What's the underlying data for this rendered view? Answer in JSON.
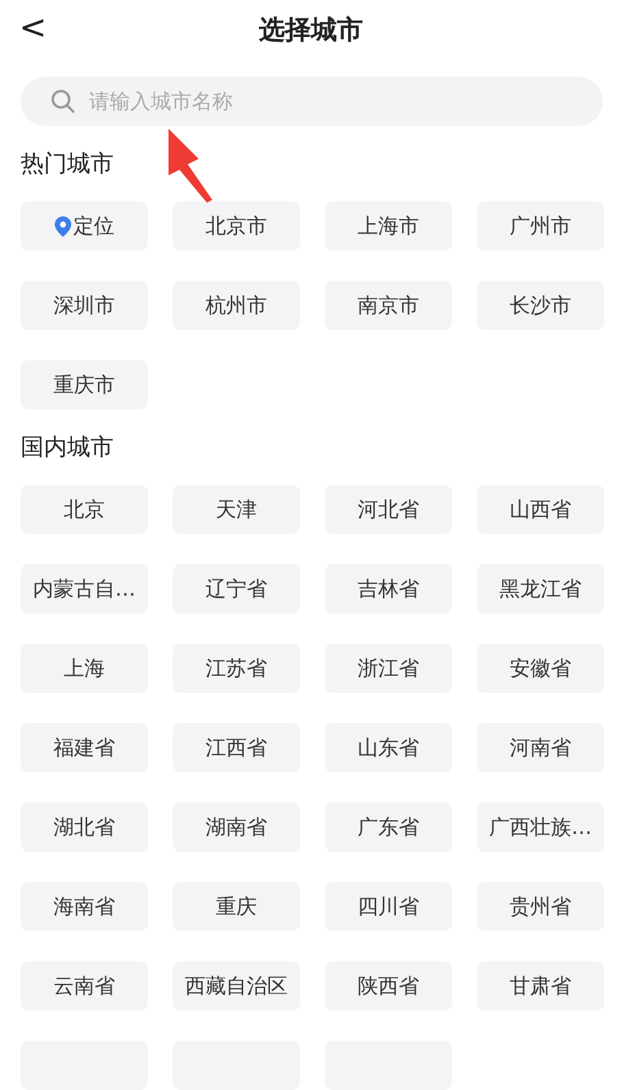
{
  "header": {
    "back": "<",
    "title": "选择城市"
  },
  "search": {
    "placeholder": "请输入城市名称"
  },
  "sections": [
    {
      "title": "热门城市",
      "items": [
        {
          "label": "定位",
          "kind": "location"
        },
        {
          "label": "北京市",
          "kind": "city"
        },
        {
          "label": "上海市",
          "kind": "city"
        },
        {
          "label": "广州市",
          "kind": "city"
        },
        {
          "label": "深圳市",
          "kind": "city"
        },
        {
          "label": "杭州市",
          "kind": "city"
        },
        {
          "label": "南京市",
          "kind": "city"
        },
        {
          "label": "长沙市",
          "kind": "city"
        },
        {
          "label": "重庆市",
          "kind": "city"
        }
      ]
    },
    {
      "title": "国内城市",
      "items": [
        {
          "label": "北京",
          "kind": "city"
        },
        {
          "label": "天津",
          "kind": "city"
        },
        {
          "label": "河北省",
          "kind": "city"
        },
        {
          "label": "山西省",
          "kind": "city"
        },
        {
          "label": "内蒙古自…",
          "kind": "city"
        },
        {
          "label": "辽宁省",
          "kind": "city"
        },
        {
          "label": "吉林省",
          "kind": "city"
        },
        {
          "label": "黑龙江省",
          "kind": "city"
        },
        {
          "label": "上海",
          "kind": "city"
        },
        {
          "label": "江苏省",
          "kind": "city"
        },
        {
          "label": "浙江省",
          "kind": "city"
        },
        {
          "label": "安徽省",
          "kind": "city"
        },
        {
          "label": "福建省",
          "kind": "city"
        },
        {
          "label": "江西省",
          "kind": "city"
        },
        {
          "label": "山东省",
          "kind": "city"
        },
        {
          "label": "河南省",
          "kind": "city"
        },
        {
          "label": "湖北省",
          "kind": "city"
        },
        {
          "label": "湖南省",
          "kind": "city"
        },
        {
          "label": "广东省",
          "kind": "city"
        },
        {
          "label": "广西壮族…",
          "kind": "city"
        },
        {
          "label": "海南省",
          "kind": "city"
        },
        {
          "label": "重庆",
          "kind": "city"
        },
        {
          "label": "四川省",
          "kind": "city"
        },
        {
          "label": "贵州省",
          "kind": "city"
        },
        {
          "label": "云南省",
          "kind": "city"
        },
        {
          "label": "西藏自治区",
          "kind": "city"
        },
        {
          "label": "陕西省",
          "kind": "city"
        },
        {
          "label": "甘肃省",
          "kind": "city"
        },
        {
          "kind": "cut"
        },
        {
          "kind": "cut"
        },
        {
          "kind": "cut"
        }
      ]
    }
  ]
}
